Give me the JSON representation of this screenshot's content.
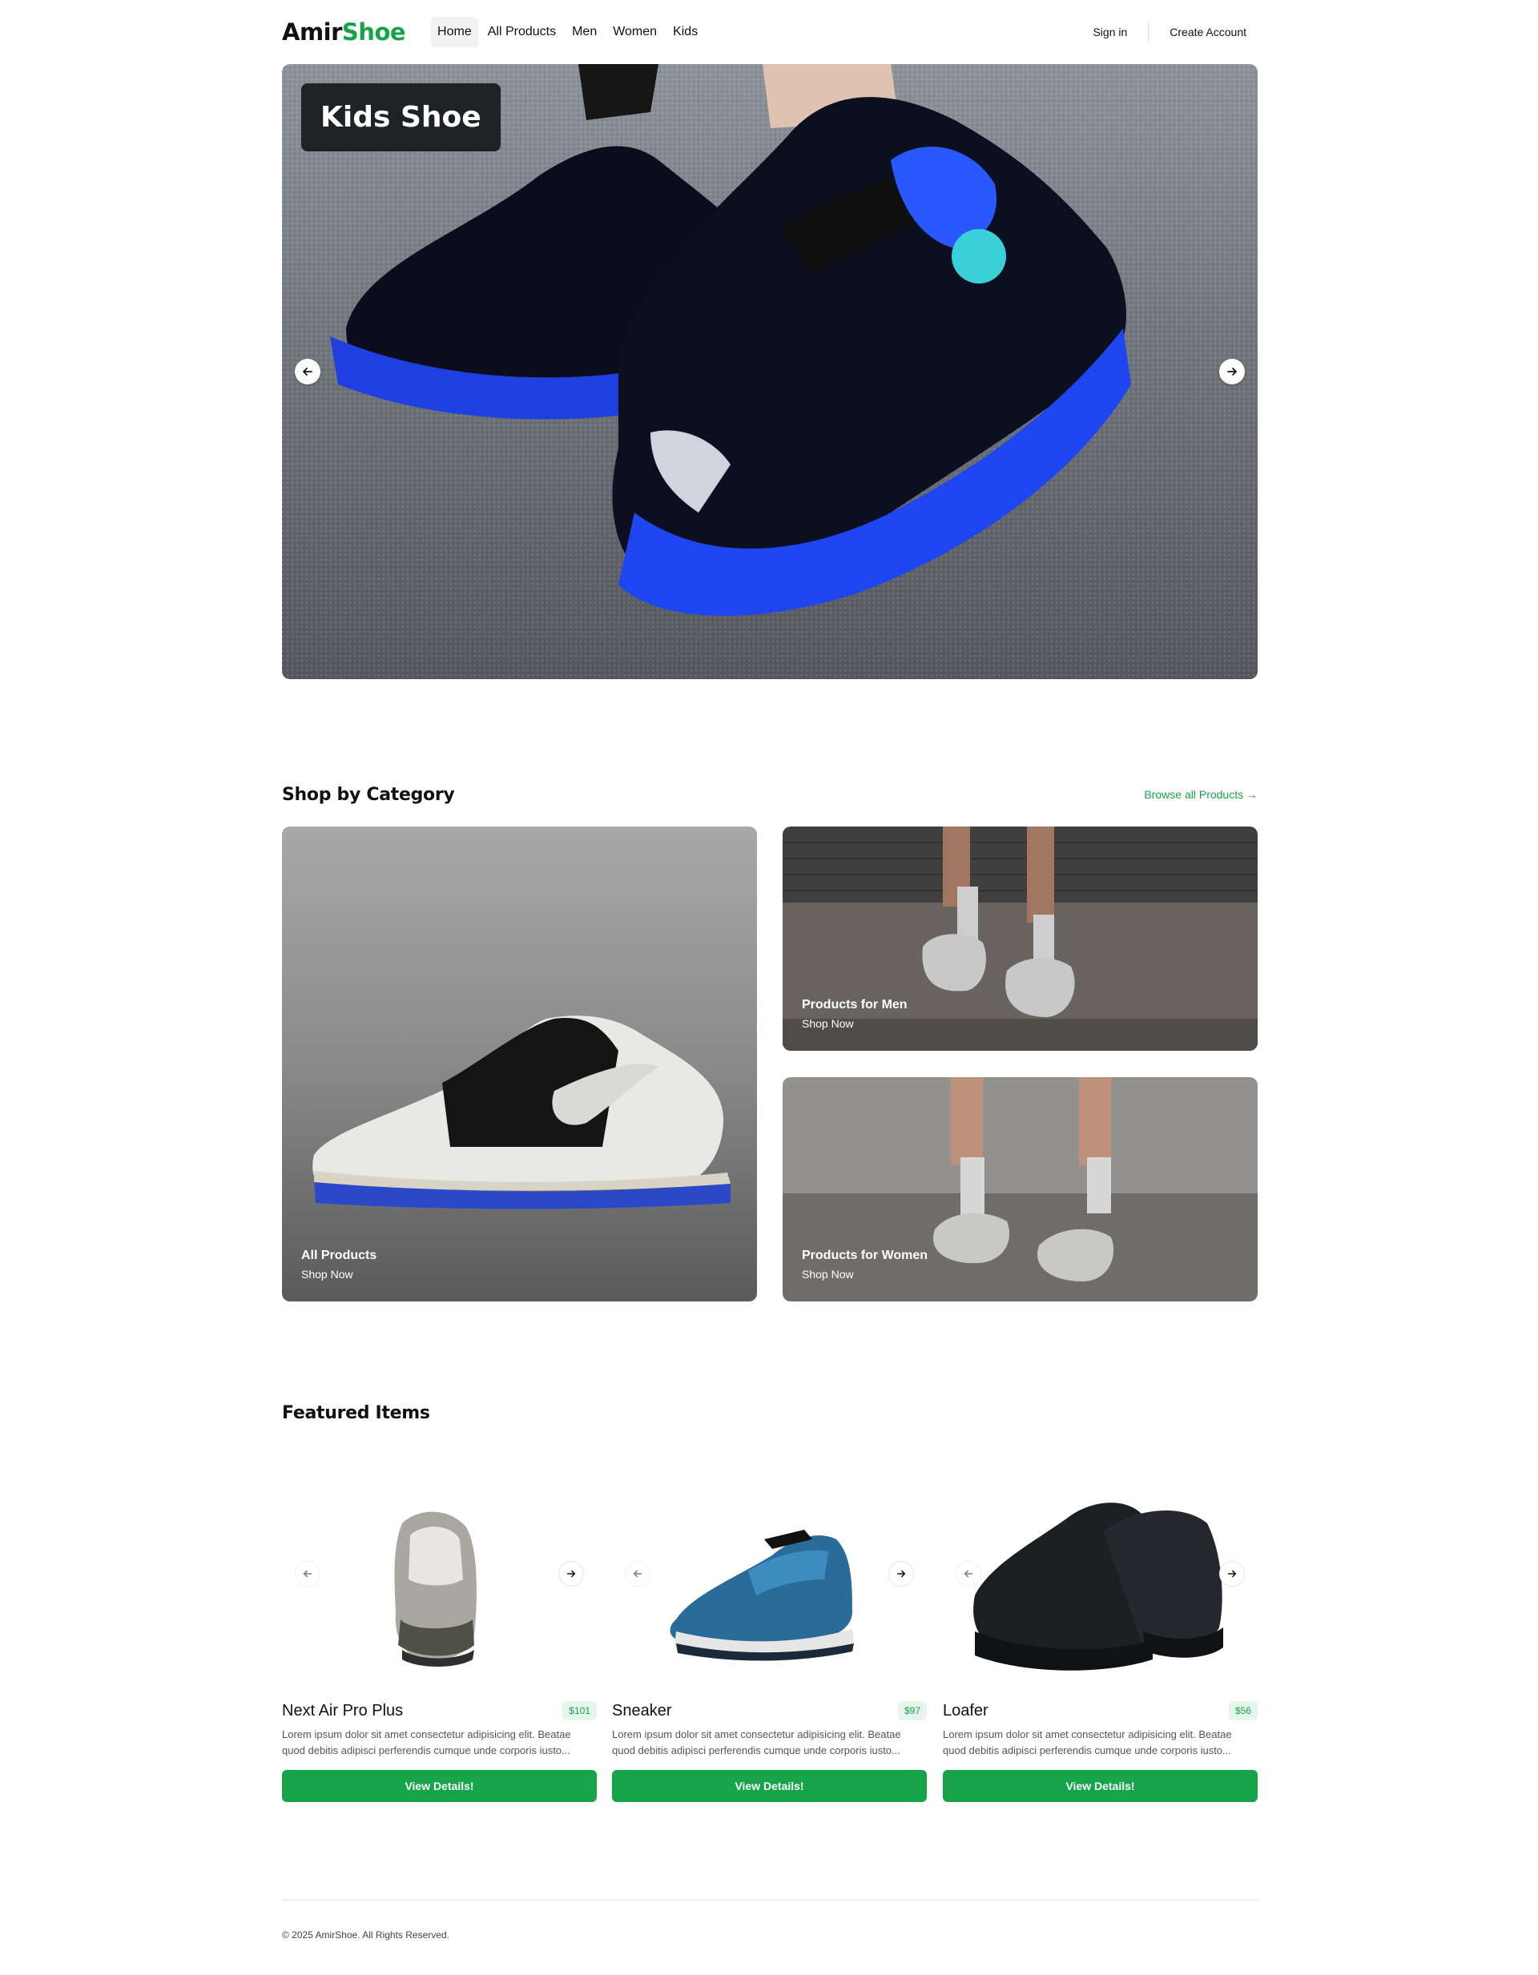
{
  "brand": {
    "part1": "Amir",
    "part2": "Shoe",
    "accent": "#16a34a"
  },
  "nav": {
    "items": [
      {
        "label": "Home",
        "active": true
      },
      {
        "label": "All Products"
      },
      {
        "label": "Men"
      },
      {
        "label": "Women"
      },
      {
        "label": "Kids"
      }
    ],
    "sign_in": "Sign in",
    "create_account": "Create Account"
  },
  "hero": {
    "title": "Kids Shoe",
    "prev_icon": "arrow-left-icon",
    "next_icon": "arrow-right-icon"
  },
  "categories": {
    "title": "Shop by Category",
    "browse_link": "Browse all Products →",
    "cards": [
      {
        "title": "All Products",
        "cta": "Shop Now"
      },
      {
        "title": "Products for Men",
        "cta": "Shop Now"
      },
      {
        "title": "Products for Women",
        "cta": "Shop Now"
      }
    ]
  },
  "featured": {
    "title": "Featured Items",
    "products": [
      {
        "name": "Next Air Pro Plus",
        "price": "$101",
        "description": "Lorem ipsum dolor sit amet consectetur adipisicing elit. Beatae quod debitis adipisci perferendis cumque unde corporis iusto...",
        "button": "View Details!"
      },
      {
        "name": "Sneaker",
        "price": "$97",
        "description": "Lorem ipsum dolor sit amet consectetur adipisicing elit. Beatae quod debitis adipisci perferendis cumque unde corporis iusto...",
        "button": "View Details!"
      },
      {
        "name": "Loafer",
        "price": "$56",
        "description": "Lorem ipsum dolor sit amet consectetur adipisicing elit. Beatae quod debitis adipisci perferendis cumque unde corporis iusto...",
        "button": "View Details!"
      }
    ]
  },
  "footer": {
    "copyright": "© 2025 AmirShoe. All Rights Reserved."
  }
}
